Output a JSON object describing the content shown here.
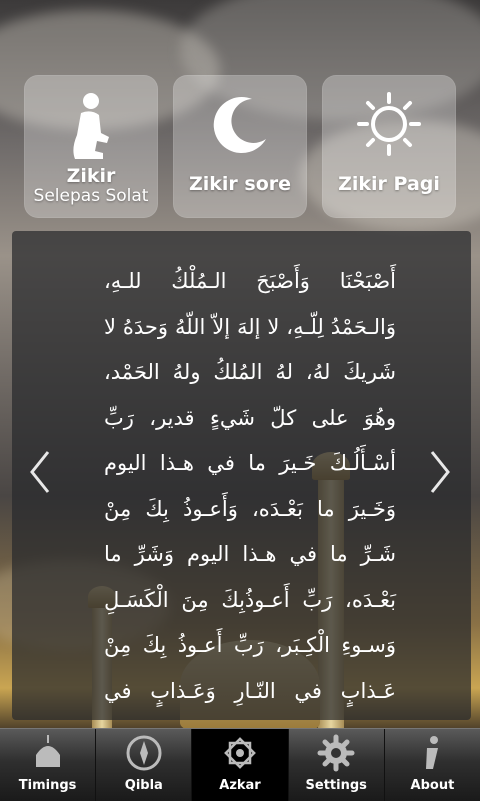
{
  "top_buttons": [
    {
      "line1": "Zikir",
      "line2": "Selepas Solat",
      "icon": "prayer-icon"
    },
    {
      "line1": "Zikir sore",
      "icon": "crescent-moon-icon"
    },
    {
      "line1": "Zikir Pagi",
      "icon": "sun-icon"
    }
  ],
  "doa": {
    "text": "أَصْبَحْنَا وَأَصْبَحَ الـمُلْكُ للـهِ، وَالـحَمْدُ لِلّـهِ، لا إلهَ إلاّ اللّهُ وَحدَهُ لا شَريكَ لهُ، لهُ المُلكُ ولهُ الحَمْد، وهُوَ على كلّ شَيءٍ قدير، رَبِّ أسْـأَلُـكَ خَـيرَ ما في هـذا اليوم وَخَـيرَ ما بَعْـدَه، وَأَعـوذُ بِكَ مِنْ شَـرِّ ما في هـذا اليوم وَشَرِّ ما بَعْـدَه، رَبِّ أَعـوذُبِكَ مِنَ الْكَسَـلِ وَسـوءِ الْكِـبَر، رَبِّ أَعـوذُ بِكَ مِنْ عَـذابٍ في النّـارِ وَعَـذابٍ في القَـبْر."
  },
  "tabs": [
    {
      "label": "Timings",
      "icon": "mosque-dome-icon",
      "active": false
    },
    {
      "label": "Qibla",
      "icon": "compass-icon",
      "active": false
    },
    {
      "label": "Azkar",
      "icon": "star-ornament-icon",
      "active": true
    },
    {
      "label": "Settings",
      "icon": "gear-icon",
      "active": false
    },
    {
      "label": "About",
      "icon": "info-icon",
      "active": false
    }
  ]
}
